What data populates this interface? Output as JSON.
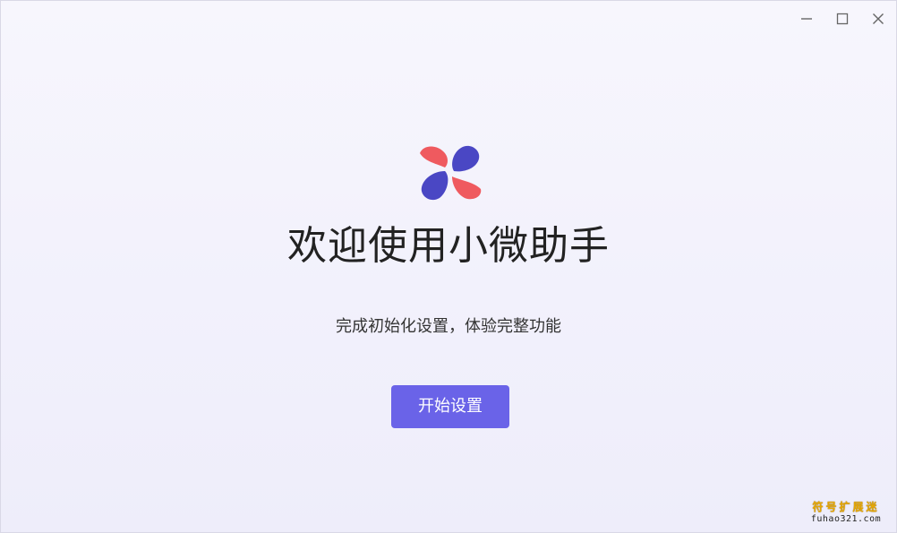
{
  "window": {
    "controls": {
      "minimize_icon": "minimize-icon",
      "maximize_icon": "maximize-icon",
      "close_icon": "close-icon"
    }
  },
  "welcome": {
    "logo_icon": "pinwheel-logo-icon",
    "title": "欢迎使用小微助手",
    "subtitle": "完成初始化设置，体验完整功能",
    "start_button_label": "开始设置"
  },
  "watermark": {
    "line1": "符号扩展迷",
    "line2": "fuhao321.com"
  },
  "colors": {
    "accent": "#6a63e8",
    "logo_red": "#ef5a5f",
    "logo_blue": "#4a47c4",
    "background": "#f4f3fc"
  }
}
